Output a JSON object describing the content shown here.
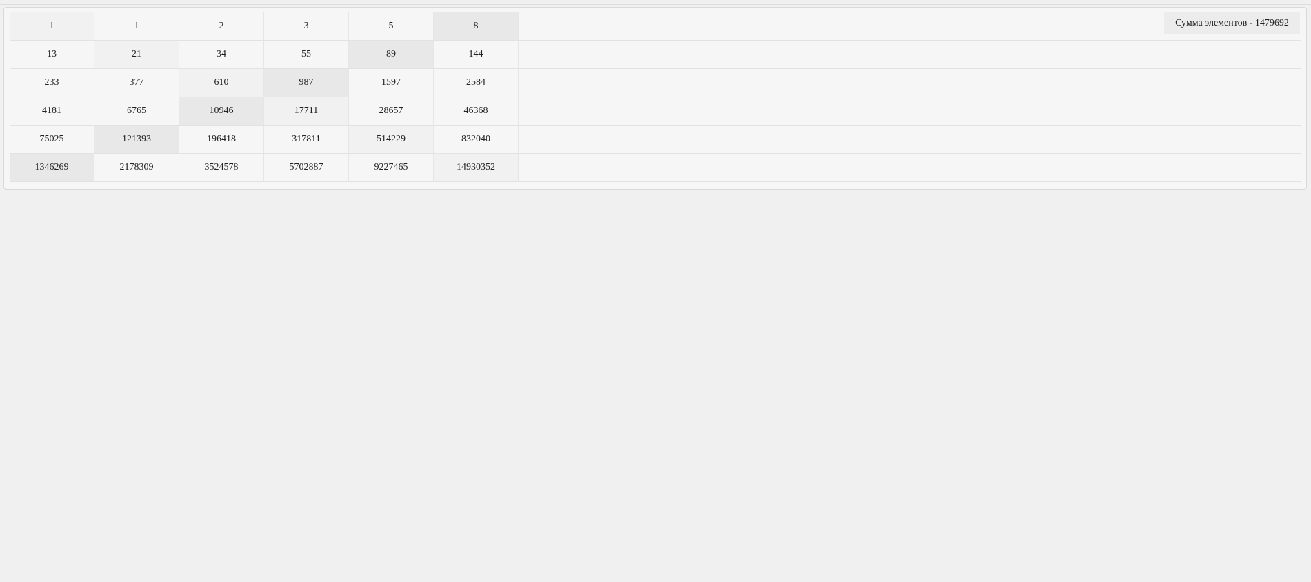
{
  "summary": {
    "label": "Сумма элементов - 1479692"
  },
  "grid": {
    "rows": [
      [
        "1",
        "1",
        "2",
        "3",
        "5",
        "8"
      ],
      [
        "13",
        "21",
        "34",
        "55",
        "89",
        "144"
      ],
      [
        "233",
        "377",
        "610",
        "987",
        "1597",
        "2584"
      ],
      [
        "4181",
        "6765",
        "10946",
        "17711",
        "28657",
        "46368"
      ],
      [
        "75025",
        "121393",
        "196418",
        "317811",
        "514229",
        "832040"
      ],
      [
        "1346269",
        "2178309",
        "3524578",
        "5702887",
        "9227465",
        "14930352"
      ]
    ]
  },
  "colors": {
    "page_bg": "#f0f0f0",
    "panel_bg": "#f6f6f6",
    "cell_highlight_light": "#f1f1f1",
    "cell_highlight_dark": "#e9e8e9"
  }
}
